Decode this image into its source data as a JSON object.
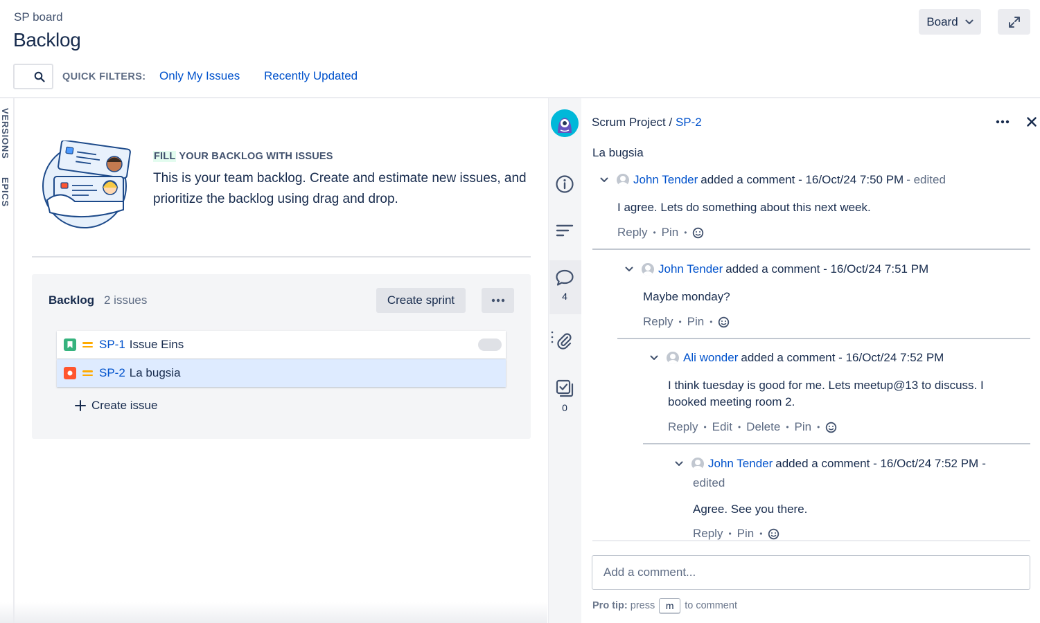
{
  "header": {
    "breadcrumb": "SP board",
    "title": "Backlog",
    "board_button": "Board",
    "quick_filters_label": "QUICK FILTERS:",
    "quick_filters": [
      "Only My Issues",
      "Recently Updated"
    ]
  },
  "left_tabs": [
    "VERSIONS",
    "EPICS"
  ],
  "empty_state": {
    "heading_highlight": "FILL",
    "heading_rest": " YOUR BACKLOG WITH ISSUES",
    "body": "This is your team backlog. Create and estimate new issues, and prioritize the backlog using drag and drop."
  },
  "backlog": {
    "title": "Backlog",
    "count": "2 issues",
    "create_sprint": "Create sprint",
    "issues": [
      {
        "key": "SP-1",
        "summary": "Issue Eins",
        "type": "story",
        "type_color": "#36b37e",
        "priority_color": "#ffab00"
      },
      {
        "key": "SP-2",
        "summary": "La bugsia",
        "type": "bug",
        "type_color": "#ff5630",
        "priority_color": "#ffab00"
      }
    ],
    "create_issue": "Create issue"
  },
  "rail": {
    "comments_count": "4",
    "checklist_count": "0"
  },
  "detail": {
    "project": "Scrum Project",
    "separator": "/",
    "issue_key": "SP-2",
    "summary": "La bugsia",
    "comments": [
      {
        "author": "John Tender",
        "verb": "added a comment -",
        "timestamp": "16/Oct/24 7:50 PM",
        "edited": "- edited",
        "body": "I agree. Lets do something about this next week.",
        "actions": [
          "Reply",
          "Pin"
        ]
      },
      {
        "author": "John Tender",
        "verb": "added a comment -",
        "timestamp": "16/Oct/24 7:51 PM",
        "body": "Maybe monday?",
        "actions": [
          "Reply",
          "Pin"
        ]
      },
      {
        "author": "Ali wonder",
        "verb": "added a comment -",
        "timestamp": "16/Oct/24 7:52 PM",
        "body": "I think tuesday is good for me. Lets meetup@13 to discuss. I booked meeting room 2.",
        "actions": [
          "Reply",
          "Edit",
          "Delete",
          "Pin"
        ]
      },
      {
        "author": "John Tender",
        "verb": "added a comment -",
        "timestamp": "16/Oct/24 7:52 PM",
        "timestamp_suffix": "-",
        "edited_line": "edited",
        "body": "Agree. See you there.",
        "actions": [
          "Reply",
          "Pin"
        ]
      }
    ],
    "add_comment_placeholder": "Add a comment...",
    "protip_label": "Pro tip:",
    "protip_press": "press",
    "protip_key": "m",
    "protip_rest": "to comment"
  },
  "colors": {
    "link": "#0052cc",
    "text": "#172b4d",
    "muted": "#5e6c84",
    "selected_row": "#deebff",
    "panel_bg": "#f4f5f7"
  }
}
